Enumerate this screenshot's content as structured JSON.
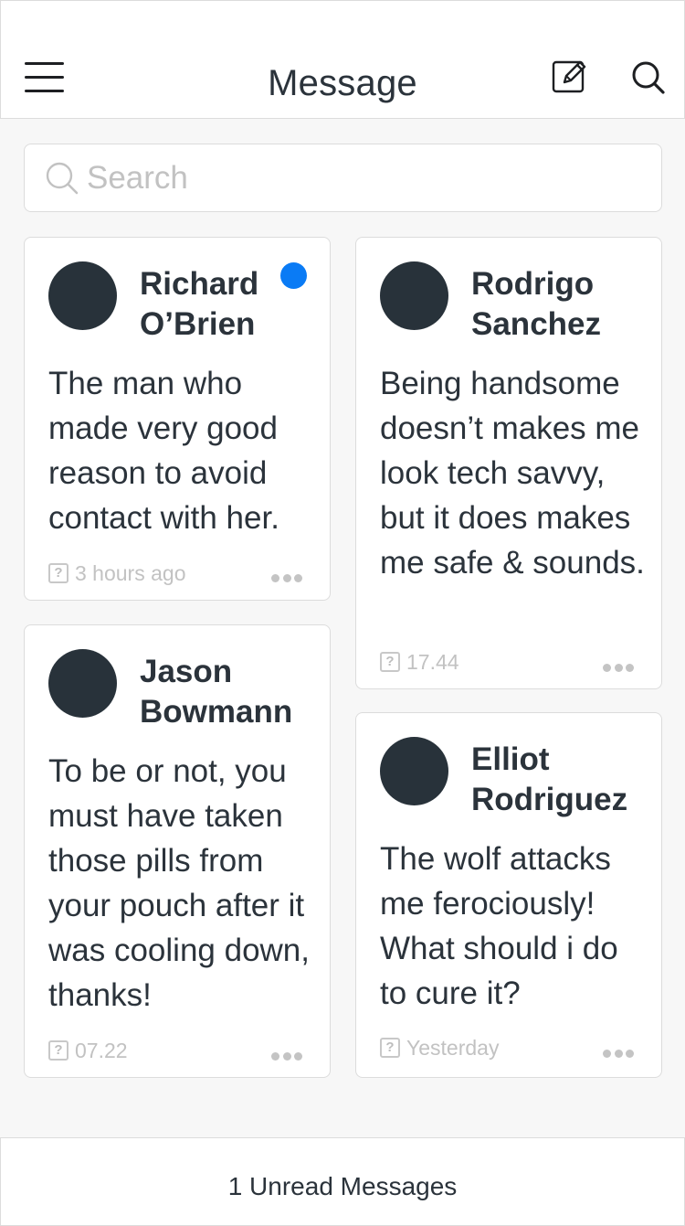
{
  "header": {
    "title": "Message",
    "left_icon": "menu-icon",
    "right_icons": [
      "compose-icon",
      "search-icon"
    ]
  },
  "search": {
    "placeholder": "Search",
    "value": ""
  },
  "cards": [
    {
      "name": "Richard O’Brien",
      "message": "The man who made very good reason to avoid contact with her.",
      "time": "3 hours ago",
      "unread": true
    },
    {
      "name": "Rodrigo Sanchez",
      "message": "Being handsome doesn’t makes me look tech savvy, but it does makes me safe & sounds.",
      "time": "17.44",
      "unread": false
    },
    {
      "name": "Jason Bowmann",
      "message": "To be or not, you must have taken those pills from your pouch after it was cooling down, thanks!",
      "time": "07.22",
      "unread": false
    },
    {
      "name": "Elliot Rodriguez",
      "message": "The wolf attacks me ferociously! What should i do to cure it?",
      "time": "Yesterday",
      "unread": false
    }
  ],
  "meta_icon_glyph": "?",
  "footer": {
    "text": "1 Unread Messages"
  },
  "colors": {
    "unread_dot": "#0a7bf5",
    "avatar": "#28323a",
    "text": "#2b333b",
    "muted": "#c2c2c2"
  }
}
